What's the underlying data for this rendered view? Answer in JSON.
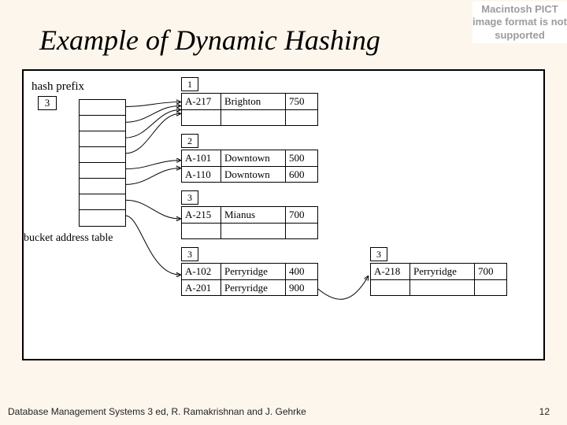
{
  "title": "Example of Dynamic Hashing",
  "pict_warning": "Macintosh PICT image format is not supported",
  "footer": {
    "left": "Database Management Systems 3 ed,  R. Ramakrishnan and J. Gehrke",
    "page": "12"
  },
  "diagram": {
    "labels": {
      "hash_prefix": "hash prefix",
      "bucket_addr": "bucket address table"
    },
    "global_depth": "3",
    "buckets": {
      "b1": {
        "local_depth": "1",
        "rows": [
          {
            "acct": "A-217",
            "city": "Brighton",
            "amt": "750"
          },
          {
            "acct": "",
            "city": "",
            "amt": ""
          }
        ]
      },
      "b2": {
        "local_depth": "2",
        "rows": [
          {
            "acct": "A-101",
            "city": "Downtown",
            "amt": "500"
          },
          {
            "acct": "A-110",
            "city": "Downtown",
            "amt": "600"
          }
        ]
      },
      "b3": {
        "local_depth": "3",
        "rows": [
          {
            "acct": "A-215",
            "city": "Mianus",
            "amt": "700"
          },
          {
            "acct": "",
            "city": "",
            "amt": ""
          }
        ]
      },
      "b4": {
        "local_depth": "3",
        "rows": [
          {
            "acct": "A-102",
            "city": "Perryridge",
            "amt": "400"
          },
          {
            "acct": "A-201",
            "city": "Perryridge",
            "amt": "900"
          }
        ]
      },
      "b5": {
        "local_depth": "3",
        "rows": [
          {
            "acct": "A-218",
            "city": "Perryridge",
            "amt": "700"
          }
        ]
      }
    }
  }
}
